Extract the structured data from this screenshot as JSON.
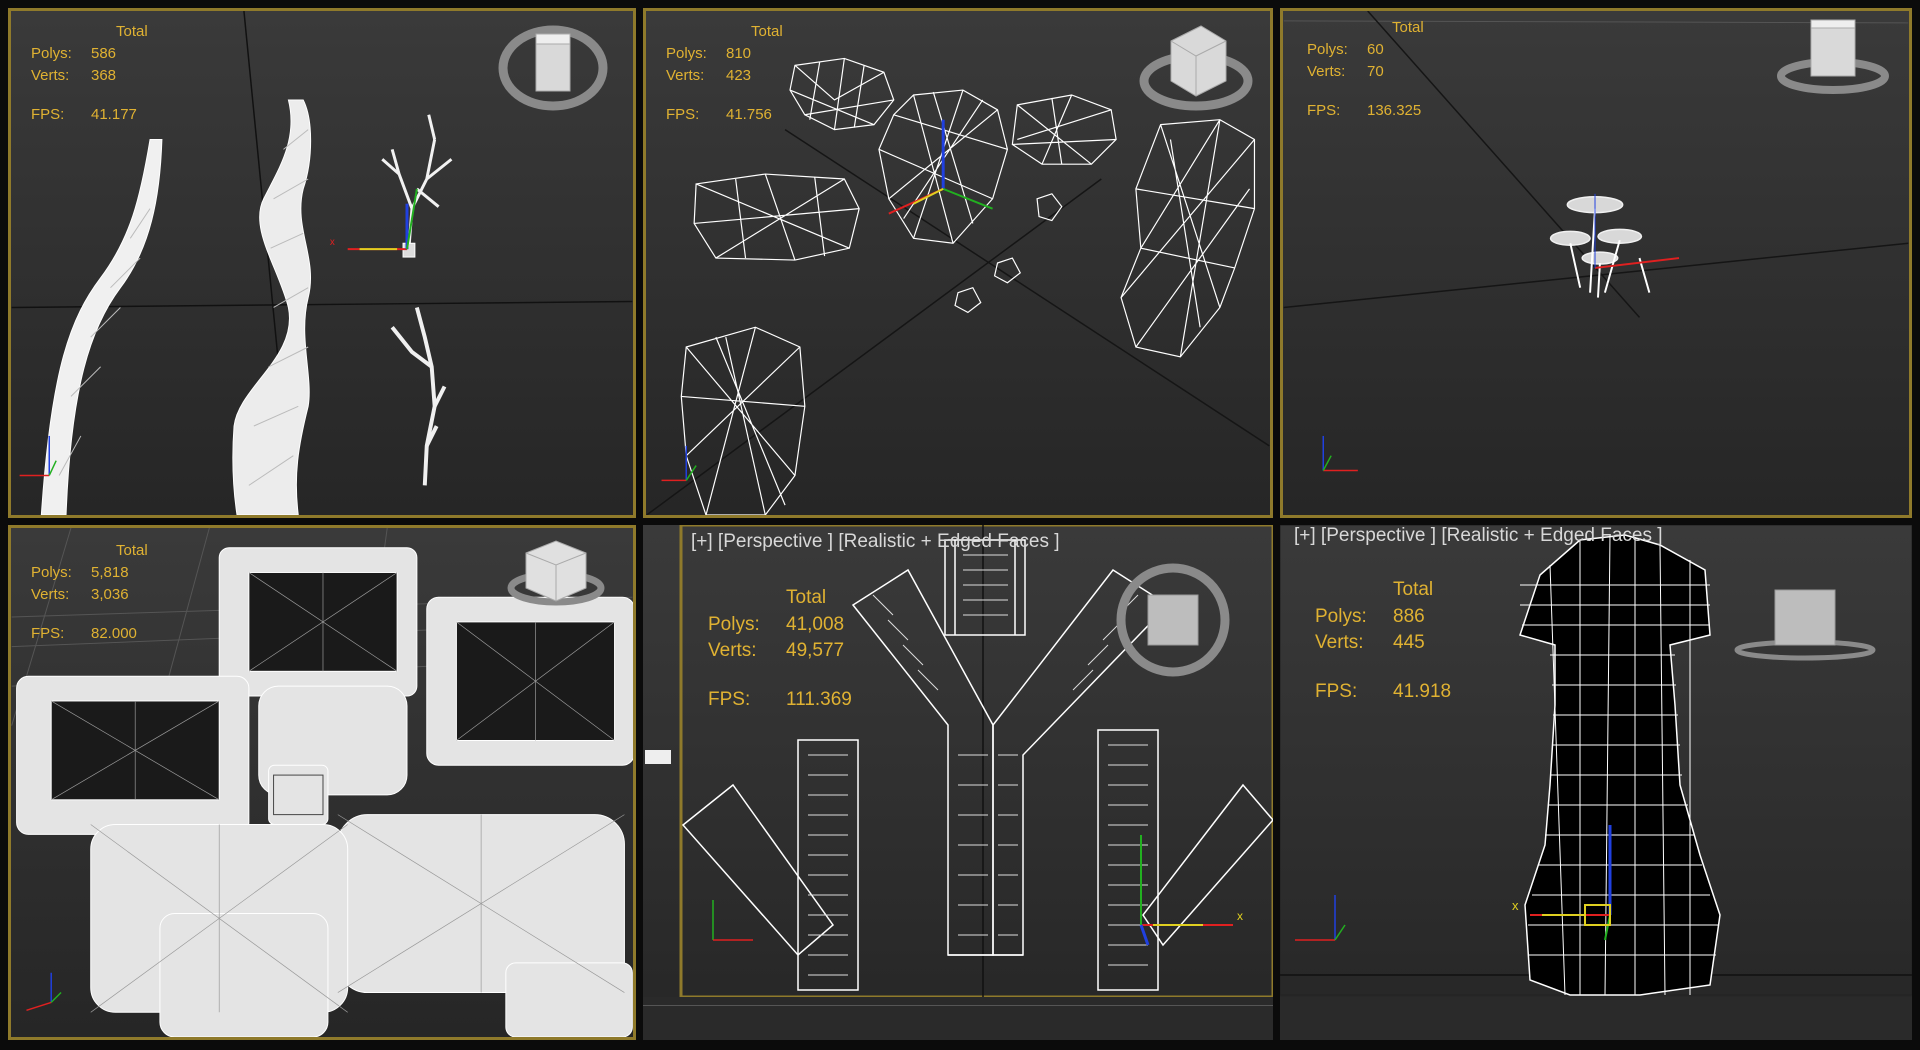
{
  "app": {
    "colors": {
      "stats_text": "#e0b232",
      "active_border": "#8f7a2b",
      "viewport_bg": "#333333",
      "wire": "#ffffff",
      "axis_x": "#e02020",
      "axis_y": "#22b020",
      "axis_z": "#2040e0"
    }
  },
  "viewports": [
    {
      "id": "vp1",
      "stats": {
        "total": "Total",
        "polys_label": "Polys:",
        "polys": "586",
        "verts_label": "Verts:",
        "verts": "368",
        "fps_label": "FPS:",
        "fps": "41.177"
      },
      "navcube_face": "BOTTOM",
      "gizmo_icon": "transform-gizmo-icon"
    },
    {
      "id": "vp2",
      "stats": {
        "total": "Total",
        "polys_label": "Polys:",
        "polys": "810",
        "verts_label": "Verts:",
        "verts": "423",
        "fps_label": "FPS:",
        "fps": "41.756"
      },
      "navcube_face": "FRONT",
      "gizmo_icon": "transform-gizmo-icon"
    },
    {
      "id": "vp3",
      "stats": {
        "total": "Total",
        "polys_label": "Polys:",
        "polys": "60",
        "verts_label": "Verts:",
        "verts": "70",
        "fps_label": "FPS:",
        "fps": "136.325"
      },
      "navcube_face": "FRONT",
      "gizmo_icon": "transform-gizmo-icon"
    },
    {
      "id": "vp4",
      "stats": {
        "total": "Total",
        "polys_label": "Polys:",
        "polys": "5,818",
        "verts_label": "Verts:",
        "verts": "3,036",
        "fps_label": "FPS:",
        "fps": "82.000"
      },
      "navcube_face": "BACK",
      "gizmo_icon": "axis-tripod-icon"
    },
    {
      "id": "vp5",
      "label": "[+] [Perspective ] [Realistic + Edged Faces ]",
      "stats": {
        "total": "Total",
        "polys_label": "Polys:",
        "polys": "41,008",
        "verts_label": "Verts:",
        "verts": "49,577",
        "fps_label": "FPS:",
        "fps": "111.369"
      },
      "navcube_face": "TOP",
      "gizmo_icon": "transform-gizmo-icon"
    },
    {
      "id": "vp6",
      "label": "[+] [Perspective ] [Realistic + Edged Faces ]",
      "stats": {
        "total": "Total",
        "polys_label": "Polys:",
        "polys": "886",
        "verts_label": "Verts:",
        "verts": "445",
        "fps_label": "FPS:",
        "fps": "41.918"
      },
      "navcube_face": "BACK",
      "gizmo_icon": "transform-gizmo-icon"
    }
  ]
}
